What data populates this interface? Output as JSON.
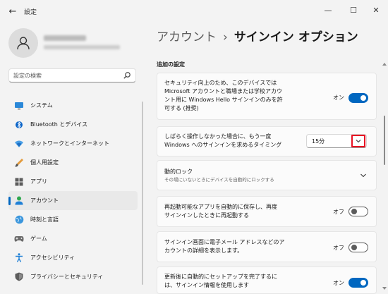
{
  "window": {
    "title": "設定",
    "back": "←",
    "minimize": "—",
    "maximize": "☐",
    "close": "✕"
  },
  "sidebar": {
    "search_placeholder": "設定の検索",
    "items": [
      {
        "label": "システム",
        "icon": "system-icon"
      },
      {
        "label": "Bluetooth とデバイス",
        "icon": "bluetooth-icon"
      },
      {
        "label": "ネットワークとインターネット",
        "icon": "network-icon"
      },
      {
        "label": "個人用設定",
        "icon": "brush-icon"
      },
      {
        "label": "アプリ",
        "icon": "apps-icon"
      },
      {
        "label": "アカウント",
        "icon": "account-icon",
        "active": true
      },
      {
        "label": "時刻と言語",
        "icon": "globe-icon"
      },
      {
        "label": "ゲーム",
        "icon": "game-icon"
      },
      {
        "label": "アクセシビリティ",
        "icon": "accessibility-icon"
      },
      {
        "label": "プライバシーとセキュリティ",
        "icon": "shield-icon"
      }
    ]
  },
  "breadcrumb": {
    "parent": "アカウント",
    "separator": "›",
    "current": "サインイン オプション"
  },
  "section_title": "追加の設定",
  "settings": {
    "windows_hello": {
      "text_line1": "セキュリティ向上のため、このデバイスでは",
      "text_line2": "Microsoft アカウントと職場または学校アカウ",
      "text_line3": "ント用に Windows Hello サインインのみを許",
      "text_line4": "可する (推奨)",
      "state_label": "オン",
      "on": true
    },
    "away_timing": {
      "text_line1": "しばらく操作しなかった場合に、もう一度",
      "text_line2": "Windows へのサインインを求めるタイミング",
      "value": "15分"
    },
    "dynamic_lock": {
      "title": "動的ロック",
      "subtitle": "その場にいないときにデバイスを自動的にロックする"
    },
    "restart_apps": {
      "text_line1": "再起動可能なアプリを自動的に保存し、再度",
      "text_line2": "サインインしたときに再起動する",
      "state_label": "オフ",
      "on": false
    },
    "show_account_details": {
      "text_line1": "サインイン画面に電子メール アドレスなどのア",
      "text_line2": "カウントの詳細を表示します。",
      "state_label": "オフ",
      "on": false
    },
    "auto_finish_setup": {
      "text_line1": "更新後に自動的にセットアップを完了するに",
      "text_line2": "は、サインイン情報を使用します",
      "state_label": "オン",
      "on": true
    }
  },
  "colors": {
    "accent": "#0067c0",
    "highlight_box": "#e81123",
    "background": "#f3f3f3",
    "card": "#fbfbfb"
  }
}
